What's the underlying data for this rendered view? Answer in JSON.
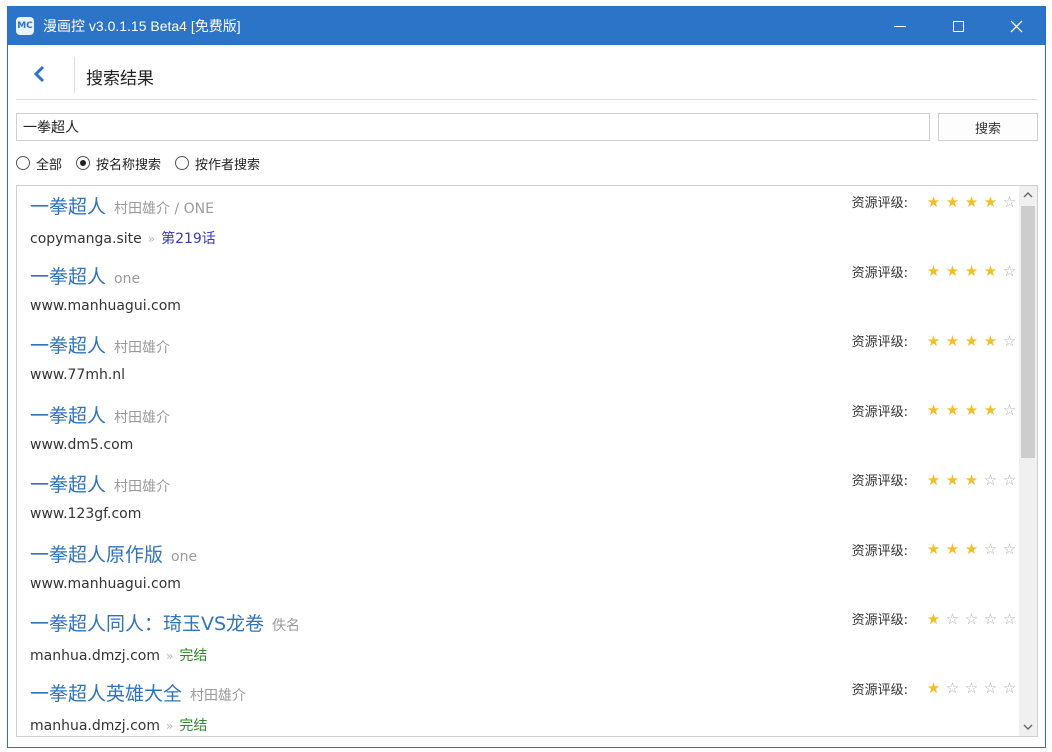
{
  "window": {
    "title": "漫画控 v3.0.1.15 Beta4 [免费版]",
    "app_icon_text": "MC"
  },
  "header": {
    "page_title": "搜索结果"
  },
  "search": {
    "value": "一拳超人",
    "button_label": "搜索"
  },
  "filters": [
    {
      "label": "全部",
      "selected": false
    },
    {
      "label": "按名称搜索",
      "selected": true
    },
    {
      "label": "按作者搜索",
      "selected": false
    }
  ],
  "rating_label": "资源评级:",
  "results": [
    {
      "title": "一拳超人",
      "author": "村田雄介 / ONE",
      "site": "copymanga.site",
      "chapter": "第219话",
      "chapter_color": "blue",
      "stars": 4
    },
    {
      "title": "一拳超人",
      "author": "one",
      "site": "www.manhuagui.com",
      "chapter": "",
      "chapter_color": "",
      "stars": 4
    },
    {
      "title": "一拳超人",
      "author": "村田雄介",
      "site": "www.77mh.nl",
      "chapter": "",
      "chapter_color": "",
      "stars": 4
    },
    {
      "title": "一拳超人",
      "author": "村田雄介",
      "site": "www.dm5.com",
      "chapter": "",
      "chapter_color": "",
      "stars": 4
    },
    {
      "title": "一拳超人",
      "author": "村田雄介",
      "site": "www.123gf.com",
      "chapter": "",
      "chapter_color": "",
      "stars": 3
    },
    {
      "title": "一拳超人原作版",
      "author": "one",
      "site": "www.manhuagui.com",
      "chapter": "",
      "chapter_color": "",
      "stars": 3
    },
    {
      "title": "一拳超人同人：琦玉VS龙卷",
      "author": "佚名",
      "site": "manhua.dmzj.com",
      "chapter": "完结",
      "chapter_color": "green",
      "stars": 1
    },
    {
      "title": "一拳超人英雄大全",
      "author": "村田雄介",
      "site": "manhua.dmzj.com",
      "chapter": "完结",
      "chapter_color": "green",
      "stars": 1
    }
  ],
  "max_stars": 5,
  "icons": {
    "back": "chevron-left-icon",
    "minimize": "minimize-icon",
    "maximize": "maximize-icon",
    "close": "close-icon",
    "star": "star-icon"
  },
  "colors": {
    "titlebar": "#2c74c7",
    "title_link": "#2f73bd",
    "star_on": "#f3be28",
    "star_off": "#b0b0b0"
  }
}
